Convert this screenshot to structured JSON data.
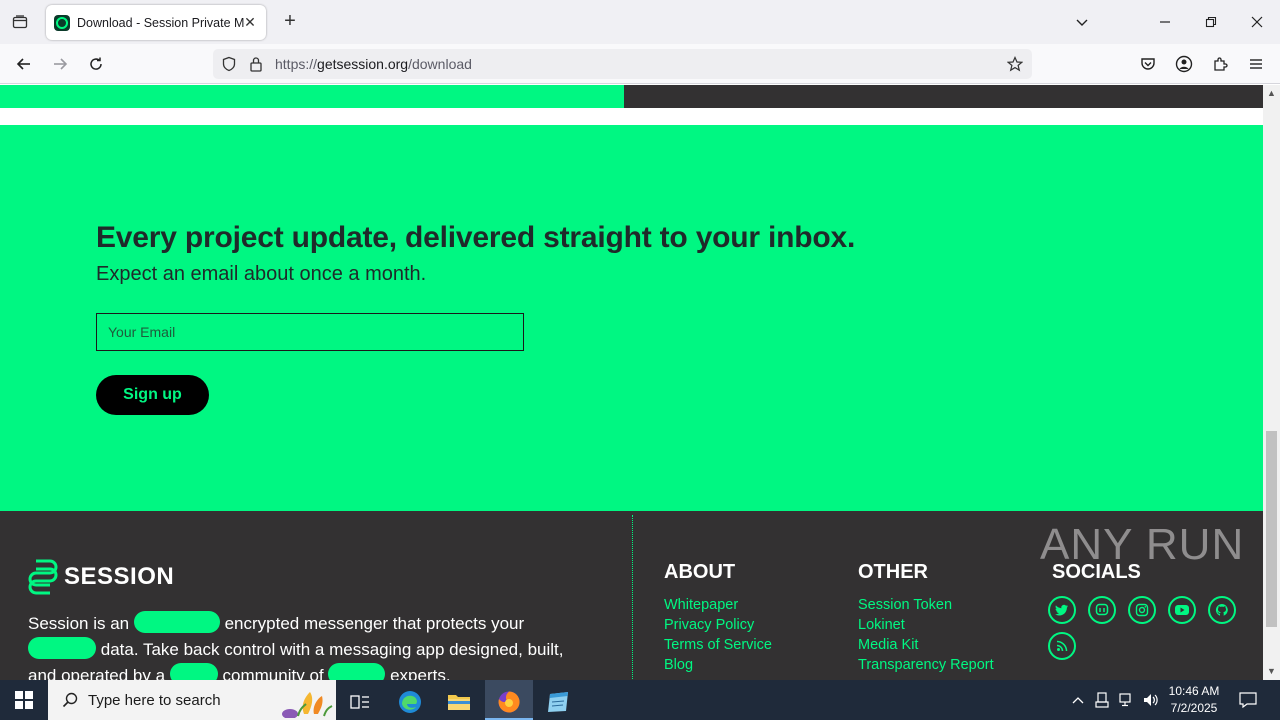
{
  "browser": {
    "tab_title": "Download - Session Private Messenger",
    "url_prefix": "https://",
    "url_host": "getsession.org",
    "url_path": "/download"
  },
  "newsletter": {
    "title": "Every project update, delivered straight to your inbox.",
    "subtitle": "Expect an email about once a month.",
    "email_placeholder": "Your Email",
    "signup_label": "Sign up"
  },
  "footer": {
    "logo_text": "SESSION",
    "about": {
      "part1": "Session is an",
      "part2": "encrypted messenger that protects your",
      "part3": "data. Take back control with a messaging app designed, built,",
      "part4": "and operated by a",
      "part5": "community of",
      "part6": "experts."
    },
    "about_col": {
      "heading": "ABOUT",
      "links": [
        "Whitepaper",
        "Privacy Policy",
        "Terms of Service",
        "Blog"
      ]
    },
    "other_col": {
      "heading": "OTHER",
      "links": [
        "Session Token",
        "Lokinet",
        "Media Kit",
        "Transparency Report"
      ]
    },
    "socials_col": {
      "heading": "SOCIALS",
      "icons": [
        "twitter-icon",
        "mastodon-icon",
        "instagram-icon",
        "youtube-icon",
        "github-icon",
        "rss-icon"
      ]
    }
  },
  "watermark": "ANY RUN",
  "taskbar": {
    "search_placeholder": "Type here to search",
    "time": "10:46 AM",
    "date": "7/2/2025"
  },
  "colors": {
    "brand_green": "#00f782",
    "footer_dark": "#333132",
    "text_dark": "#1f2a2a"
  }
}
